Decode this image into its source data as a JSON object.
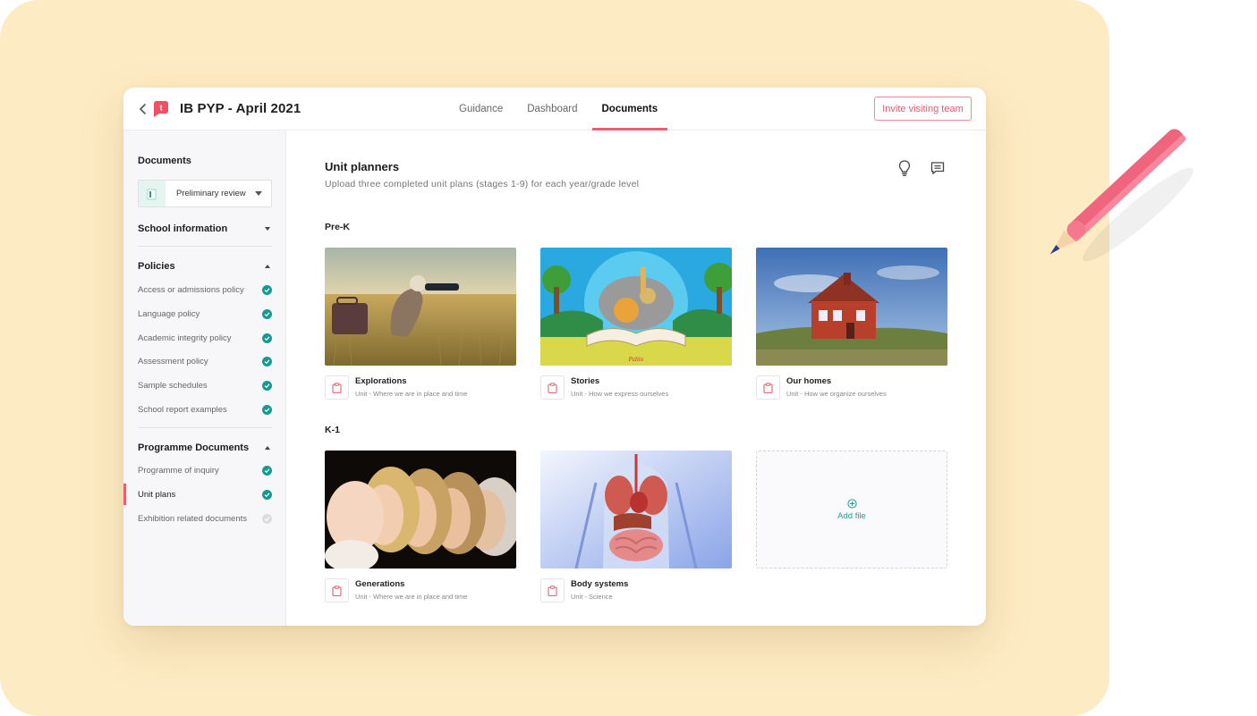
{
  "header": {
    "title": "IB PYP - April 2021",
    "tabs": [
      {
        "label": "Guidance",
        "active": false
      },
      {
        "label": "Dashboard",
        "active": false
      },
      {
        "label": "Documents",
        "active": true
      }
    ],
    "invite_label": "Invite visiting team"
  },
  "sidebar": {
    "heading": "Documents",
    "stage_select": {
      "value": "Preliminary review"
    },
    "sections": [
      {
        "label": "School information",
        "expanded": false,
        "items": []
      },
      {
        "label": "Policies",
        "expanded": true,
        "items": [
          {
            "label": "Access or admissions policy",
            "status": "complete"
          },
          {
            "label": "Language policy",
            "status": "complete"
          },
          {
            "label": "Academic integrity policy",
            "status": "complete"
          },
          {
            "label": "Assessment policy",
            "status": "complete"
          },
          {
            "label": "Sample schedules",
            "status": "complete"
          },
          {
            "label": "School report examples",
            "status": "complete"
          }
        ]
      },
      {
        "label": "Programme Documents",
        "expanded": true,
        "items": [
          {
            "label": "Programme of inquiry",
            "status": "complete"
          },
          {
            "label": "Unit plans",
            "status": "complete",
            "current": true
          },
          {
            "label": "Exhibition related documents",
            "status": "pending"
          }
        ]
      }
    ]
  },
  "main": {
    "title": "Unit planners",
    "subtitle": "Upload three completed unit plans (stages 1-9) for each year/grade level",
    "groups": [
      {
        "label": "Pre-K",
        "cards": [
          {
            "title": "Explorations",
            "subtitle": "Unit - Where we are in place and time",
            "image": "child-with-binoculars-in-field"
          },
          {
            "title": "Stories",
            "subtitle": "Unit - How we express ourselves",
            "image": "animals-popping-out-of-storybook"
          },
          {
            "title": "Our homes",
            "subtitle": "Unit - How we organize ourselves",
            "image": "red-house-on-hill"
          }
        ]
      },
      {
        "label": "K-1",
        "cards": [
          {
            "title": "Generations",
            "subtitle": "Unit - Where we are in place and time",
            "image": "faces-across-generations"
          },
          {
            "title": "Body systems",
            "subtitle": "Unit - Science",
            "image": "human-anatomy-organs"
          }
        ],
        "add_label": "Add file"
      }
    ]
  },
  "colors": {
    "accent": "#e8606d",
    "teal": "#149a93",
    "backdrop": "#fdebc4"
  }
}
